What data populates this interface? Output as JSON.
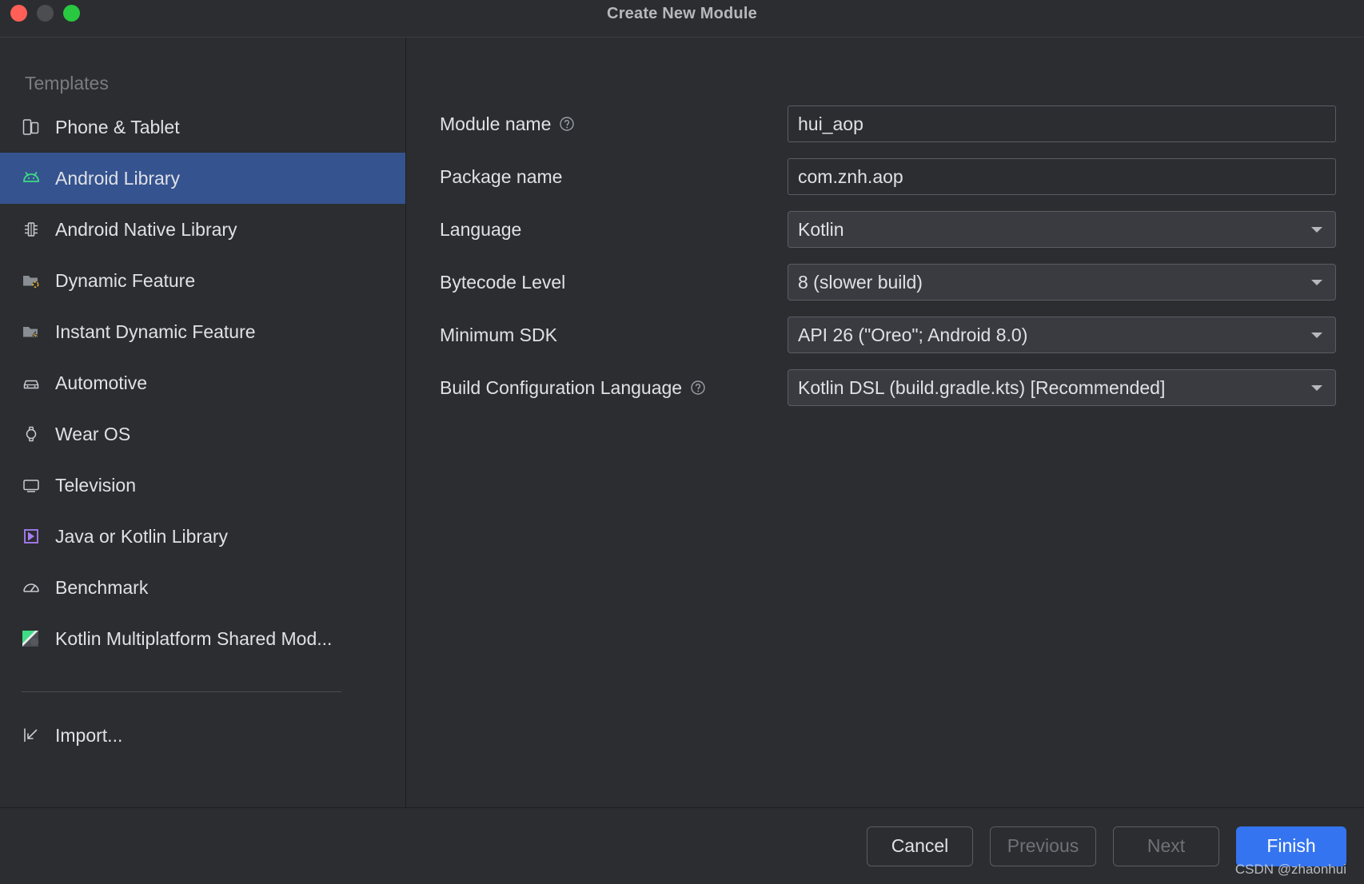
{
  "window": {
    "title": "Create New Module",
    "traffic_lights": [
      "close-red",
      "minimize-yellow",
      "zoom-green"
    ]
  },
  "sidebar": {
    "header": "Templates",
    "items": [
      {
        "label": "Phone & Tablet",
        "icon": "phone-tablet-icon",
        "selected": false
      },
      {
        "label": "Android Library",
        "icon": "android-robot-icon",
        "selected": true
      },
      {
        "label": "Android Native Library",
        "icon": "native-chip-icon",
        "selected": false
      },
      {
        "label": "Dynamic Feature",
        "icon": "folder-dynamic-icon",
        "selected": false
      },
      {
        "label": "Instant Dynamic Feature",
        "icon": "folder-instant-icon",
        "selected": false
      },
      {
        "label": "Automotive",
        "icon": "car-icon",
        "selected": false
      },
      {
        "label": "Wear OS",
        "icon": "watch-icon",
        "selected": false
      },
      {
        "label": "Television",
        "icon": "tv-icon",
        "selected": false
      },
      {
        "label": "Java or Kotlin Library",
        "icon": "kotlin-library-icon",
        "selected": false
      },
      {
        "label": "Benchmark",
        "icon": "benchmark-gauge-icon",
        "selected": false
      },
      {
        "label": "Kotlin Multiplatform Shared Mod...",
        "icon": "kotlin-multiplatform-icon",
        "selected": false
      }
    ],
    "import_label": "Import...",
    "import_icon": "import-arrow-icon"
  },
  "form": {
    "rows": [
      {
        "label": "Module name",
        "help": true,
        "type": "text",
        "value": "hui_aop"
      },
      {
        "label": "Package name",
        "help": false,
        "type": "text",
        "value": "com.znh.aop"
      },
      {
        "label": "Language",
        "help": false,
        "type": "select",
        "value": "Kotlin"
      },
      {
        "label": "Bytecode Level",
        "help": false,
        "type": "select",
        "value": "8 (slower build)"
      },
      {
        "label": "Minimum SDK",
        "help": false,
        "type": "select",
        "value": "API 26 (\"Oreo\"; Android 8.0)"
      },
      {
        "label": "Build Configuration Language",
        "help": true,
        "type": "select",
        "value": "Kotlin DSL (build.gradle.kts) [Recommended]"
      }
    ]
  },
  "footer": {
    "cancel": "Cancel",
    "previous": "Previous",
    "next": "Next",
    "finish": "Finish",
    "watermark": "CSDN @zhaonhui"
  },
  "colors": {
    "background": "#2b2d30",
    "selection": "#35538f",
    "accent": "#3574f0",
    "android_green": "#3ddc84",
    "kotlin_purple": "#a97ef5",
    "warning_amber": "#e8b33a"
  }
}
